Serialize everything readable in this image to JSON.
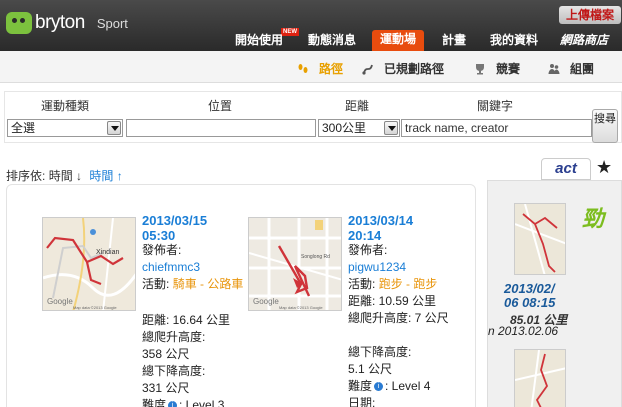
{
  "header": {
    "brand": "bryton",
    "product": "Sport",
    "upload_label": "上傳檔案",
    "new_badge": "NEW",
    "nav": [
      {
        "label": "開始使用",
        "active": false
      },
      {
        "label": "動態消息",
        "active": false
      },
      {
        "label": "運動場",
        "active": true
      },
      {
        "label": "計畫",
        "active": false
      },
      {
        "label": "我的資料",
        "active": false
      },
      {
        "label": "網路商店",
        "active": false
      }
    ]
  },
  "subnav": {
    "items": [
      {
        "label": "路徑",
        "icon": "footsteps-icon",
        "active": true
      },
      {
        "label": "已規劃路徑",
        "icon": "map-route-icon",
        "active": false
      },
      {
        "label": "競賽",
        "icon": "trophy-icon",
        "active": false
      },
      {
        "label": "組團",
        "icon": "group-icon",
        "active": false
      }
    ]
  },
  "filters": {
    "sport_label": "運動種類",
    "sport_value": "全選",
    "location_label": "位置",
    "location_value": "",
    "distance_label": "距離",
    "distance_value": "300公里",
    "keyword_label": "關鍵字",
    "keyword_placeholder": "track name, creator",
    "search_label": "搜尋"
  },
  "sort": {
    "label": "排序依:",
    "time_desc": "時間",
    "time_asc": "時間"
  },
  "tabs": {
    "act_label": "act",
    "star_label": "★"
  },
  "colors": {
    "accent": "#e84c0e",
    "link": "#1a7ed6",
    "activity": "#e8950c",
    "brand_green": "#7cc13e"
  },
  "tracks": [
    {
      "date": "2013/03/15",
      "time": "05:30",
      "creator_label": "發佈者:",
      "creator": "chiefmmc3",
      "activity_label": "活動:",
      "activity": "騎車 - 公路車",
      "distance_line": "距離: 16.64 公里",
      "ascent_label": "總爬升高度:",
      "ascent": "358 公尺",
      "descent_label": "總下降高度:",
      "descent": "331 公尺",
      "difficulty_label": "難度",
      "difficulty": ": Level 3",
      "map_places": [
        "Xindian"
      ]
    },
    {
      "date": "2013/03/14",
      "time": "20:14",
      "creator_label": "發佈者:",
      "creator": "pigwu1234",
      "activity_label": "活動:",
      "activity": "跑步 - 跑步",
      "distance_line": "距離: 10.59 公里",
      "ascent_label": "總爬升高度: 7 公尺",
      "descent_label": "總下降高度:",
      "descent": "5.1 公尺",
      "difficulty_label": "難度",
      "difficulty": ": Level 4",
      "date_label": "日期:",
      "map_places": [
        "Songlong Rd"
      ]
    }
  ],
  "side": {
    "date1": "2013/02/",
    "date2": "06 08:15",
    "distance": "85.01 公里",
    "date_line": "n 2013.02.06",
    "motto": "勁"
  },
  "map_credit": "Map data ©2013 Google"
}
